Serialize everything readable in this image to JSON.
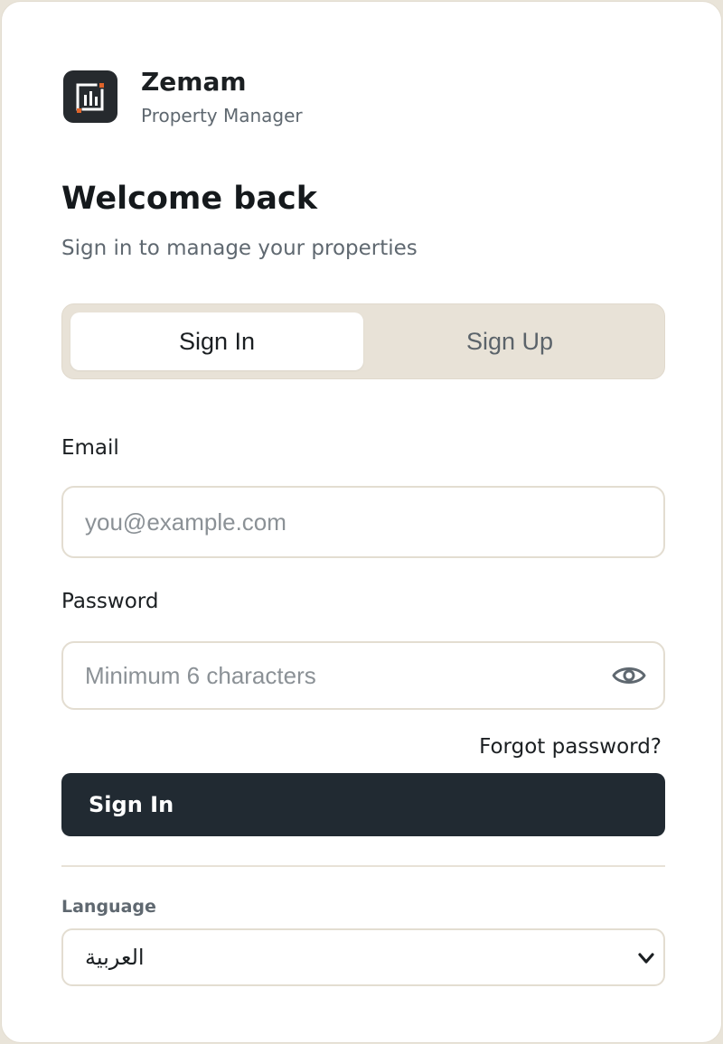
{
  "brand": {
    "name": "Zemam",
    "subtitle": "Property Manager",
    "logo_icon": "bar-chart-logo-icon",
    "accent_color": "#e0642a"
  },
  "heading": {
    "title": "Welcome back",
    "subtitle": "Sign in to manage your properties"
  },
  "tabs": [
    {
      "label": "Sign In",
      "active": true
    },
    {
      "label": "Sign Up",
      "active": false
    }
  ],
  "form": {
    "email": {
      "label": "Email",
      "placeholder": "you@example.com",
      "value": ""
    },
    "password": {
      "label": "Password",
      "placeholder": "Minimum 6 characters",
      "value": "",
      "toggle_icon": "eye-icon"
    },
    "forgot_label": "Forgot password?",
    "submit_label": "Sign In"
  },
  "language": {
    "label": "Language",
    "selected": "العربية",
    "icon": "chevron-down-icon"
  },
  "colors": {
    "primary_button": "#212a32",
    "tab_track": "#e8e2d7",
    "muted_text": "#5f6870"
  }
}
